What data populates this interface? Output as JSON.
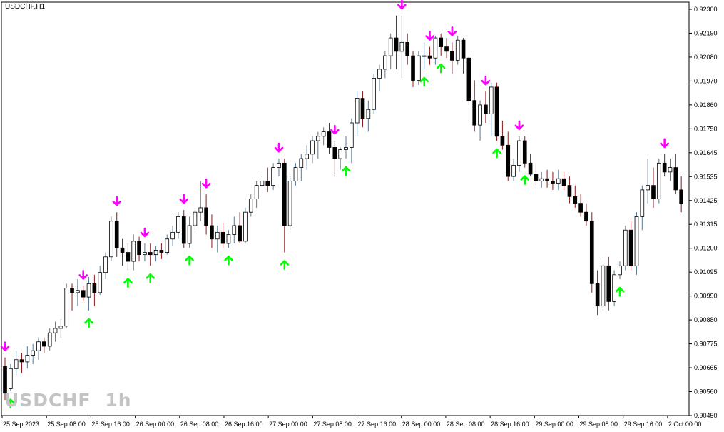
{
  "window": {
    "symbol_label": "USDCHF,H1"
  },
  "watermark": {
    "symbol": "USDCHF",
    "timeframe": "1h"
  },
  "colors": {
    "background": "#ffffff",
    "bull_body": "#ffffff",
    "bear_body": "#000000",
    "wick_up": "#5b7a95",
    "wick_down": "#8b1a1a",
    "buy_arrow": "#00ff00",
    "sell_arrow": "#ff00ff",
    "axis": "#000000"
  },
  "chart_data": {
    "type": "candlestick",
    "ylim": [
      0.9045,
      0.923
    ],
    "y_ticks": [
      "0.92300",
      "0.92190",
      "0.92080",
      "0.91970",
      "0.91860",
      "0.91750",
      "0.91645",
      "0.91535",
      "0.91425",
      "0.91315",
      "0.91200",
      "0.91095",
      "0.90990",
      "0.90880",
      "0.90775",
      "0.90665",
      "0.90560",
      "0.90450"
    ],
    "x_ticks": [
      "25 Sep 2023",
      "25 Sep 08:00",
      "25 Sep 16:00",
      "26 Sep 00:00",
      "26 Sep 08:00",
      "26 Sep 16:00",
      "27 Sep 00:00",
      "27 Sep 08:00",
      "27 Sep 16:00",
      "28 Sep 00:00",
      "28 Sep 08:00",
      "28 Sep 16:00",
      "29 Sep 00:00",
      "29 Sep 08:00",
      "29 Sep 16:00",
      "2 Oct 00:00"
    ],
    "candles": [
      [
        0.9067,
        0.9071,
        0.9052,
        0.9055
      ],
      [
        0.9057,
        0.9068,
        0.9056,
        0.9066
      ],
      [
        0.9066,
        0.9074,
        0.9063,
        0.907
      ],
      [
        0.907,
        0.9073,
        0.9064,
        0.9069
      ],
      [
        0.9069,
        0.9076,
        0.9066,
        0.9072
      ],
      [
        0.9072,
        0.9077,
        0.9068,
        0.9074
      ],
      [
        0.9074,
        0.908,
        0.907,
        0.9078
      ],
      [
        0.9078,
        0.908,
        0.9073,
        0.9076
      ],
      [
        0.9076,
        0.9084,
        0.9074,
        0.9082
      ],
      [
        0.9082,
        0.9087,
        0.9078,
        0.9084
      ],
      [
        0.9084,
        0.9088,
        0.908,
        0.9085
      ],
      [
        0.9085,
        0.9104,
        0.9084,
        0.9102
      ],
      [
        0.9102,
        0.9104,
        0.9092,
        0.91
      ],
      [
        0.91,
        0.9106,
        0.9094,
        0.9101
      ],
      [
        0.9101,
        0.9103,
        0.9096,
        0.9098
      ],
      [
        0.9098,
        0.9107,
        0.9092,
        0.9104
      ],
      [
        0.9104,
        0.9108,
        0.9094,
        0.91
      ],
      [
        0.91,
        0.9112,
        0.9099,
        0.9109
      ],
      [
        0.9109,
        0.9118,
        0.9106,
        0.9116
      ],
      [
        0.9116,
        0.9134,
        0.9114,
        0.9132
      ],
      [
        0.9132,
        0.9136,
        0.9116,
        0.912
      ],
      [
        0.912,
        0.9124,
        0.9112,
        0.9118
      ],
      [
        0.9118,
        0.9122,
        0.911,
        0.9114
      ],
      [
        0.9114,
        0.9126,
        0.911,
        0.9123
      ],
      [
        0.9123,
        0.9125,
        0.9114,
        0.9117
      ],
      [
        0.9117,
        0.9122,
        0.9114,
        0.9118
      ],
      [
        0.9118,
        0.9122,
        0.9112,
        0.9117
      ],
      [
        0.9117,
        0.9121,
        0.9114,
        0.9119
      ],
      [
        0.9119,
        0.9122,
        0.9115,
        0.9118
      ],
      [
        0.9118,
        0.9126,
        0.9117,
        0.9124
      ],
      [
        0.9124,
        0.913,
        0.9121,
        0.9127
      ],
      [
        0.9127,
        0.9136,
        0.9124,
        0.9134
      ],
      [
        0.9134,
        0.9137,
        0.912,
        0.9122
      ],
      [
        0.9122,
        0.9134,
        0.912,
        0.913
      ],
      [
        0.913,
        0.9138,
        0.9128,
        0.9136
      ],
      [
        0.9136,
        0.915,
        0.9132,
        0.9138
      ],
      [
        0.9138,
        0.9144,
        0.9126,
        0.913
      ],
      [
        0.913,
        0.9135,
        0.912,
        0.9124
      ],
      [
        0.9124,
        0.913,
        0.9118,
        0.9127
      ],
      [
        0.9127,
        0.9131,
        0.912,
        0.9122
      ],
      [
        0.9122,
        0.9128,
        0.912,
        0.9126
      ],
      [
        0.9126,
        0.9134,
        0.9122,
        0.913
      ],
      [
        0.913,
        0.9136,
        0.9122,
        0.9123
      ],
      [
        0.9123,
        0.9138,
        0.9122,
        0.9136
      ],
      [
        0.9136,
        0.9144,
        0.9134,
        0.9142
      ],
      [
        0.9142,
        0.915,
        0.9138,
        0.9148
      ],
      [
        0.9148,
        0.9152,
        0.9142,
        0.915
      ],
      [
        0.915,
        0.9156,
        0.9145,
        0.9148
      ],
      [
        0.9148,
        0.9158,
        0.9146,
        0.9156
      ],
      [
        0.9156,
        0.916,
        0.9152,
        0.9158
      ],
      [
        0.9158,
        0.916,
        0.9118,
        0.913
      ],
      [
        0.913,
        0.9152,
        0.9128,
        0.915
      ],
      [
        0.915,
        0.9158,
        0.9148,
        0.9156
      ],
      [
        0.9156,
        0.9162,
        0.915,
        0.916
      ],
      [
        0.916,
        0.9166,
        0.9155,
        0.9162
      ],
      [
        0.9162,
        0.917,
        0.9158,
        0.9168
      ],
      [
        0.9168,
        0.9172,
        0.916,
        0.917
      ],
      [
        0.917,
        0.9174,
        0.9166,
        0.9172
      ],
      [
        0.9172,
        0.9176,
        0.9162,
        0.9165
      ],
      [
        0.9165,
        0.9168,
        0.9152,
        0.916
      ],
      [
        0.916,
        0.9165,
        0.9155,
        0.9164
      ],
      [
        0.9164,
        0.917,
        0.916,
        0.9165
      ],
      [
        0.9165,
        0.9178,
        0.9158,
        0.9176
      ],
      [
        0.9176,
        0.919,
        0.917,
        0.9187
      ],
      [
        0.9187,
        0.919,
        0.9174,
        0.9178
      ],
      [
        0.9178,
        0.9186,
        0.9172,
        0.9182
      ],
      [
        0.9182,
        0.9198,
        0.918,
        0.9196
      ],
      [
        0.9196,
        0.9202,
        0.919,
        0.92
      ],
      [
        0.92,
        0.9208,
        0.9196,
        0.9206
      ],
      [
        0.9206,
        0.9216,
        0.92,
        0.9214
      ],
      [
        0.9214,
        0.9224,
        0.92,
        0.9208
      ],
      [
        0.9208,
        0.9224,
        0.9196,
        0.9212
      ],
      [
        0.9212,
        0.9216,
        0.9202,
        0.9206
      ],
      [
        0.9206,
        0.9208,
        0.9192,
        0.9195
      ],
      [
        0.9195,
        0.9208,
        0.9193,
        0.9206
      ],
      [
        0.9206,
        0.9212,
        0.92,
        0.9206
      ],
      [
        0.9206,
        0.921,
        0.9202,
        0.9205
      ],
      [
        0.9205,
        0.9215,
        0.9202,
        0.9214
      ],
      [
        0.9214,
        0.9216,
        0.9206,
        0.921
      ],
      [
        0.921,
        0.9214,
        0.9205,
        0.9208
      ],
      [
        0.9208,
        0.9212,
        0.9198,
        0.9204
      ],
      [
        0.9204,
        0.9215,
        0.9202,
        0.9213
      ],
      [
        0.9213,
        0.9214,
        0.9198,
        0.9205
      ],
      [
        0.9205,
        0.9206,
        0.9184,
        0.9186
      ],
      [
        0.9186,
        0.9195,
        0.9172,
        0.9175
      ],
      [
        0.9175,
        0.9186,
        0.9168,
        0.9184
      ],
      [
        0.9184,
        0.919,
        0.9176,
        0.918
      ],
      [
        0.918,
        0.9194,
        0.917,
        0.9192
      ],
      [
        0.9192,
        0.9194,
        0.9168,
        0.917
      ],
      [
        0.917,
        0.9177,
        0.9164,
        0.9166
      ],
      [
        0.9166,
        0.9172,
        0.915,
        0.9152
      ],
      [
        0.9152,
        0.916,
        0.915,
        0.9157
      ],
      [
        0.9157,
        0.917,
        0.9154,
        0.9168
      ],
      [
        0.9168,
        0.917,
        0.9156,
        0.9158
      ],
      [
        0.9158,
        0.9162,
        0.9152,
        0.9153
      ],
      [
        0.9153,
        0.9158,
        0.9148,
        0.915
      ],
      [
        0.915,
        0.9154,
        0.9147,
        0.9151
      ],
      [
        0.9151,
        0.9155,
        0.9147,
        0.915
      ],
      [
        0.915,
        0.9154,
        0.9146,
        0.9149
      ],
      [
        0.9149,
        0.9155,
        0.9146,
        0.9151
      ],
      [
        0.9151,
        0.9154,
        0.9146,
        0.9148
      ],
      [
        0.9148,
        0.9152,
        0.914,
        0.9143
      ],
      [
        0.9143,
        0.9148,
        0.9138,
        0.914
      ],
      [
        0.914,
        0.9144,
        0.9134,
        0.9136
      ],
      [
        0.9136,
        0.914,
        0.913,
        0.9132
      ],
      [
        0.9132,
        0.9136,
        0.91,
        0.9104
      ],
      [
        0.9104,
        0.911,
        0.909,
        0.9094
      ],
      [
        0.9094,
        0.9114,
        0.9092,
        0.9112
      ],
      [
        0.9112,
        0.9116,
        0.9092,
        0.9096
      ],
      [
        0.9096,
        0.911,
        0.9094,
        0.9108
      ],
      [
        0.9108,
        0.9114,
        0.9106,
        0.9112
      ],
      [
        0.9112,
        0.913,
        0.911,
        0.9128
      ],
      [
        0.9128,
        0.9132,
        0.911,
        0.9112
      ],
      [
        0.9112,
        0.9136,
        0.9108,
        0.9134
      ],
      [
        0.9134,
        0.9148,
        0.9128,
        0.9146
      ],
      [
        0.9146,
        0.916,
        0.914,
        0.9148
      ],
      [
        0.9148,
        0.9156,
        0.9138,
        0.9142
      ],
      [
        0.9142,
        0.916,
        0.914,
        0.9158
      ],
      [
        0.9158,
        0.9162,
        0.9152,
        0.9154
      ],
      [
        0.9154,
        0.916,
        0.915,
        0.9156
      ],
      [
        0.9156,
        0.9162,
        0.9144,
        0.9146
      ],
      [
        0.9146,
        0.9152,
        0.9136,
        0.914
      ]
    ],
    "buy_signals": [
      1,
      15,
      22,
      26,
      33,
      40,
      50,
      61,
      75,
      78,
      88,
      93,
      110
    ],
    "sell_signals": [
      0,
      14,
      20,
      25,
      32,
      36,
      49,
      59,
      71,
      76,
      80,
      86,
      92,
      118
    ]
  }
}
